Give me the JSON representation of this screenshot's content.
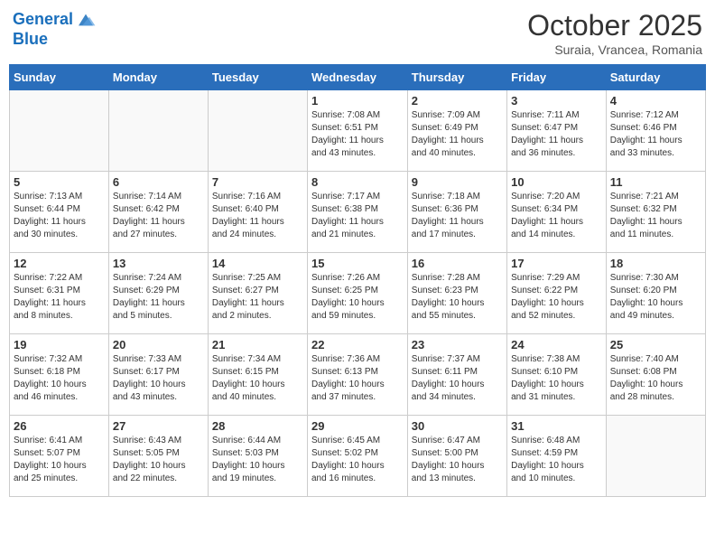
{
  "header": {
    "logo_line1": "General",
    "logo_line2": "Blue",
    "month": "October 2025",
    "location": "Suraia, Vrancea, Romania"
  },
  "weekdays": [
    "Sunday",
    "Monday",
    "Tuesday",
    "Wednesday",
    "Thursday",
    "Friday",
    "Saturday"
  ],
  "weeks": [
    [
      {
        "day": "",
        "info": ""
      },
      {
        "day": "",
        "info": ""
      },
      {
        "day": "",
        "info": ""
      },
      {
        "day": "1",
        "info": "Sunrise: 7:08 AM\nSunset: 6:51 PM\nDaylight: 11 hours\nand 43 minutes."
      },
      {
        "day": "2",
        "info": "Sunrise: 7:09 AM\nSunset: 6:49 PM\nDaylight: 11 hours\nand 40 minutes."
      },
      {
        "day": "3",
        "info": "Sunrise: 7:11 AM\nSunset: 6:47 PM\nDaylight: 11 hours\nand 36 minutes."
      },
      {
        "day": "4",
        "info": "Sunrise: 7:12 AM\nSunset: 6:46 PM\nDaylight: 11 hours\nand 33 minutes."
      }
    ],
    [
      {
        "day": "5",
        "info": "Sunrise: 7:13 AM\nSunset: 6:44 PM\nDaylight: 11 hours\nand 30 minutes."
      },
      {
        "day": "6",
        "info": "Sunrise: 7:14 AM\nSunset: 6:42 PM\nDaylight: 11 hours\nand 27 minutes."
      },
      {
        "day": "7",
        "info": "Sunrise: 7:16 AM\nSunset: 6:40 PM\nDaylight: 11 hours\nand 24 minutes."
      },
      {
        "day": "8",
        "info": "Sunrise: 7:17 AM\nSunset: 6:38 PM\nDaylight: 11 hours\nand 21 minutes."
      },
      {
        "day": "9",
        "info": "Sunrise: 7:18 AM\nSunset: 6:36 PM\nDaylight: 11 hours\nand 17 minutes."
      },
      {
        "day": "10",
        "info": "Sunrise: 7:20 AM\nSunset: 6:34 PM\nDaylight: 11 hours\nand 14 minutes."
      },
      {
        "day": "11",
        "info": "Sunrise: 7:21 AM\nSunset: 6:32 PM\nDaylight: 11 hours\nand 11 minutes."
      }
    ],
    [
      {
        "day": "12",
        "info": "Sunrise: 7:22 AM\nSunset: 6:31 PM\nDaylight: 11 hours\nand 8 minutes."
      },
      {
        "day": "13",
        "info": "Sunrise: 7:24 AM\nSunset: 6:29 PM\nDaylight: 11 hours\nand 5 minutes."
      },
      {
        "day": "14",
        "info": "Sunrise: 7:25 AM\nSunset: 6:27 PM\nDaylight: 11 hours\nand 2 minutes."
      },
      {
        "day": "15",
        "info": "Sunrise: 7:26 AM\nSunset: 6:25 PM\nDaylight: 10 hours\nand 59 minutes."
      },
      {
        "day": "16",
        "info": "Sunrise: 7:28 AM\nSunset: 6:23 PM\nDaylight: 10 hours\nand 55 minutes."
      },
      {
        "day": "17",
        "info": "Sunrise: 7:29 AM\nSunset: 6:22 PM\nDaylight: 10 hours\nand 52 minutes."
      },
      {
        "day": "18",
        "info": "Sunrise: 7:30 AM\nSunset: 6:20 PM\nDaylight: 10 hours\nand 49 minutes."
      }
    ],
    [
      {
        "day": "19",
        "info": "Sunrise: 7:32 AM\nSunset: 6:18 PM\nDaylight: 10 hours\nand 46 minutes."
      },
      {
        "day": "20",
        "info": "Sunrise: 7:33 AM\nSunset: 6:17 PM\nDaylight: 10 hours\nand 43 minutes."
      },
      {
        "day": "21",
        "info": "Sunrise: 7:34 AM\nSunset: 6:15 PM\nDaylight: 10 hours\nand 40 minutes."
      },
      {
        "day": "22",
        "info": "Sunrise: 7:36 AM\nSunset: 6:13 PM\nDaylight: 10 hours\nand 37 minutes."
      },
      {
        "day": "23",
        "info": "Sunrise: 7:37 AM\nSunset: 6:11 PM\nDaylight: 10 hours\nand 34 minutes."
      },
      {
        "day": "24",
        "info": "Sunrise: 7:38 AM\nSunset: 6:10 PM\nDaylight: 10 hours\nand 31 minutes."
      },
      {
        "day": "25",
        "info": "Sunrise: 7:40 AM\nSunset: 6:08 PM\nDaylight: 10 hours\nand 28 minutes."
      }
    ],
    [
      {
        "day": "26",
        "info": "Sunrise: 6:41 AM\nSunset: 5:07 PM\nDaylight: 10 hours\nand 25 minutes."
      },
      {
        "day": "27",
        "info": "Sunrise: 6:43 AM\nSunset: 5:05 PM\nDaylight: 10 hours\nand 22 minutes."
      },
      {
        "day": "28",
        "info": "Sunrise: 6:44 AM\nSunset: 5:03 PM\nDaylight: 10 hours\nand 19 minutes."
      },
      {
        "day": "29",
        "info": "Sunrise: 6:45 AM\nSunset: 5:02 PM\nDaylight: 10 hours\nand 16 minutes."
      },
      {
        "day": "30",
        "info": "Sunrise: 6:47 AM\nSunset: 5:00 PM\nDaylight: 10 hours\nand 13 minutes."
      },
      {
        "day": "31",
        "info": "Sunrise: 6:48 AM\nSunset: 4:59 PM\nDaylight: 10 hours\nand 10 minutes."
      },
      {
        "day": "",
        "info": ""
      }
    ]
  ]
}
